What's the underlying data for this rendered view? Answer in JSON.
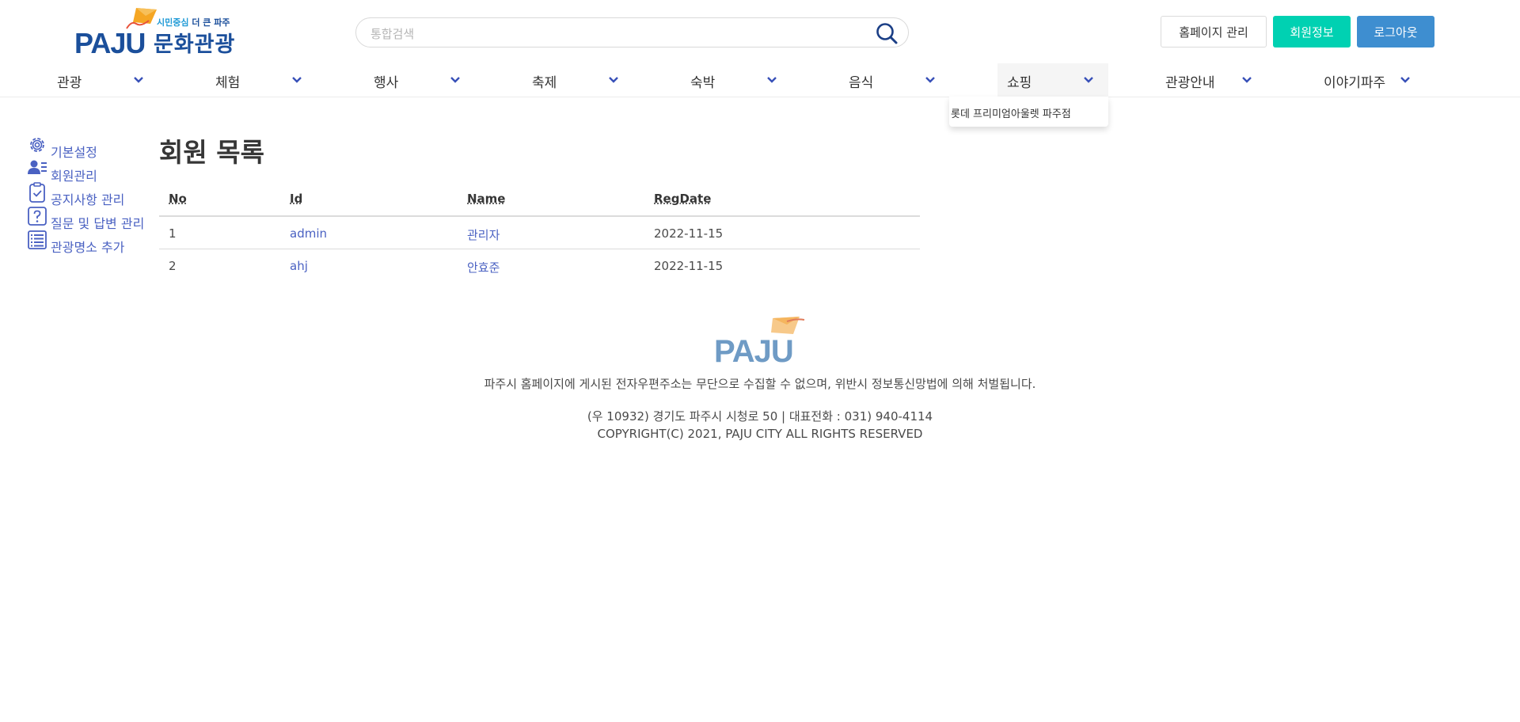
{
  "header": {
    "logo": {
      "brand": "PAJU",
      "tagline_a": "시민중심",
      "tagline_b": "더 큰 파주",
      "title": "문화관광"
    },
    "search": {
      "placeholder": "통합검색",
      "value": ""
    },
    "buttons": {
      "admin": "홈페이지 관리",
      "member_info": "회원정보",
      "logout": "로그아웃"
    }
  },
  "nav": {
    "items": [
      {
        "label": "관광"
      },
      {
        "label": "체험"
      },
      {
        "label": "행사"
      },
      {
        "label": "축제"
      },
      {
        "label": "숙박"
      },
      {
        "label": "음식"
      },
      {
        "label": "쇼핑"
      },
      {
        "label": "관광안내"
      },
      {
        "label": "이야기파주"
      }
    ],
    "active_item": "쇼핑",
    "dropdown": {
      "items": [
        {
          "label": "롯데 프리미엄아울렛 파주점"
        }
      ]
    }
  },
  "sidebar": {
    "items": [
      {
        "label": "기본설정",
        "icon": "gear-icon"
      },
      {
        "label": "회원관리",
        "icon": "user-list-icon"
      },
      {
        "label": "공지사항 관리",
        "icon": "clipboard-check-icon"
      },
      {
        "label": "질문 및 답변 관리",
        "icon": "question-box-icon"
      },
      {
        "label": "관광명소 추가",
        "icon": "list-doc-icon"
      }
    ]
  },
  "main": {
    "title": "회원 목록",
    "table": {
      "headers": [
        "No",
        "Id",
        "Name",
        "RegDate"
      ],
      "rows": [
        [
          "1",
          "admin",
          "관리자",
          "2022-11-15"
        ],
        [
          "2",
          "ahj",
          "안효준",
          "2022-11-15"
        ]
      ]
    }
  },
  "footer": {
    "brand": "PAJU",
    "notice": "파주시 홈페이지에 게시된 전자우편주소는 무단으로 수집할 수 없으며, 위반시 정보통신망법에 의해 처벌됩니다.",
    "address": "(우 10932) 경기도 파주시 시청로 50 | 대표전화 : 031) 940-4114",
    "copyright": "COPYRIGHT(C) 2021, PAJU CITY ALL RIGHTS RESERVED"
  },
  "colors": {
    "brand_blue": "#1b4f9b",
    "link": "#4a61c2",
    "primary_teal": "#00d1b2",
    "info_blue": "#3e8ed0",
    "kite_orange": "#f5a623",
    "chevron": "#3850b8"
  }
}
